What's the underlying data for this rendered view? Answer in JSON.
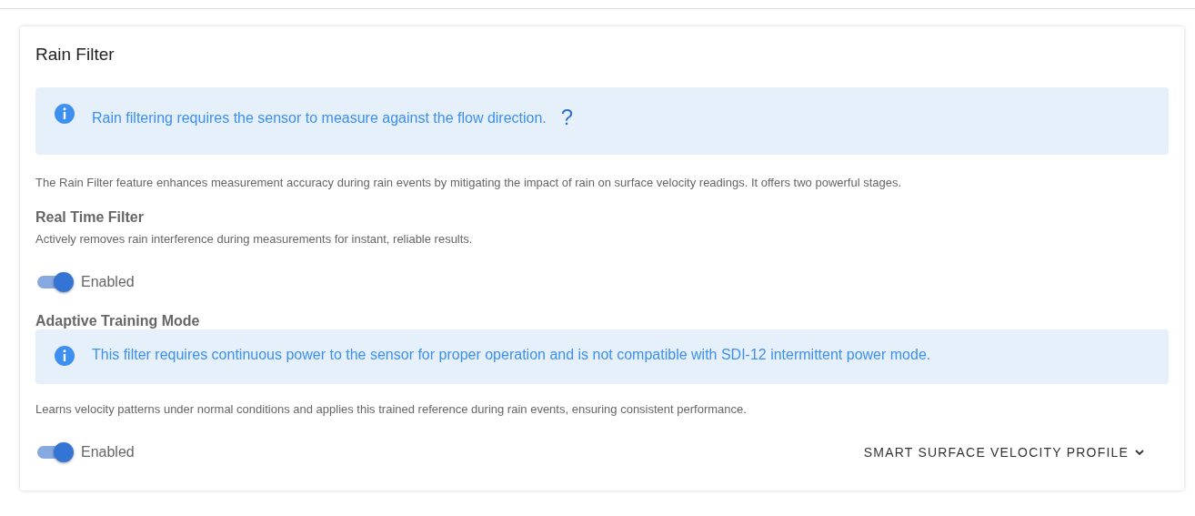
{
  "card": {
    "title": "Rain Filter",
    "alert": {
      "text": "Rain filtering requires the sensor to measure against the flow direction.",
      "help": "?"
    },
    "description": "The Rain Filter feature enhances measurement accuracy during rain events by mitigating the impact of rain on surface velocity readings. It offers two powerful stages.",
    "sections": [
      {
        "title": "Real Time Filter",
        "description": "Actively removes rain interference during measurements for instant, reliable results.",
        "toggle": {
          "label": "Enabled",
          "on": true
        }
      },
      {
        "title": "Adaptive Training Mode",
        "alert": {
          "text": "This filter requires continuous power to the sensor for proper operation and is not compatible with SDI-12 intermittent power mode."
        },
        "description": "Learns velocity patterns under normal conditions and applies this trained reference during rain events, ensuring consistent performance.",
        "toggle": {
          "label": "Enabled",
          "on": true
        },
        "button": {
          "label": "SMART SURFACE VELOCITY PROFILE",
          "expanded": false
        }
      }
    ]
  }
}
